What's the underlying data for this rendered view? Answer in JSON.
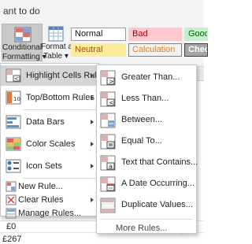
{
  "ribbon": {
    "tell_me": "ant to do",
    "conditional_formatting": {
      "line1": "Conditional",
      "line2": "Formatting ▾"
    },
    "format_as_table": {
      "line1": "Format as",
      "line2": "Table ▾"
    },
    "styles": {
      "normal": "Normal",
      "bad": "Bad",
      "good": "Good",
      "neutral": "Neutral",
      "calculation": "Calculation",
      "check": "Check"
    }
  },
  "sheet": {
    "values": [
      "£0",
      "£267"
    ]
  },
  "main_menu": {
    "items": [
      {
        "label": "Highlight Cells Rules",
        "submenu": true
      },
      {
        "label": "Top/Bottom Rules",
        "submenu": true
      },
      {
        "label": "Data Bars",
        "submenu": true
      },
      {
        "label": "Color Scales",
        "submenu": true
      },
      {
        "label": "Icon Sets",
        "submenu": true
      },
      {
        "label": "New Rule..."
      },
      {
        "label": "Clear Rules",
        "submenu": true
      },
      {
        "label": "Manage Rules..."
      }
    ]
  },
  "sub_menu": {
    "items": [
      {
        "label": "Greater Than..."
      },
      {
        "label": "Less Than..."
      },
      {
        "label": "Between..."
      },
      {
        "label": "Equal To..."
      },
      {
        "label": "Text that Contains..."
      },
      {
        "label": "A Date Occurring..."
      },
      {
        "label": "Duplicate Values..."
      }
    ],
    "more_rules": "More Rules..."
  },
  "colors": {
    "menu_highlight": "#d5d5d5",
    "button_pressed": "#c9c9c9",
    "bad_fill": "#ffc7ce",
    "good_fill": "#c6efce",
    "neutral_fill": "#ffeb9c"
  }
}
